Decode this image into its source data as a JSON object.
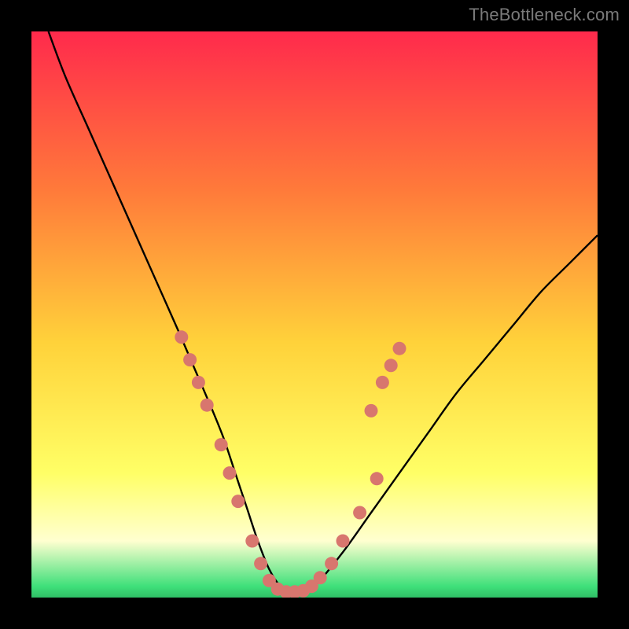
{
  "watermark": "TheBottleneck.com",
  "colors": {
    "gradient_top": "#ff2a4c",
    "gradient_mid_upper": "#ff7a3a",
    "gradient_mid": "#ffd23a",
    "gradient_lower": "#ffff66",
    "gradient_pale": "#ffffd0",
    "gradient_bottom": "#3fe07a",
    "curve": "#000000",
    "marker_fill": "#d8766e",
    "marker_stroke": "#bb5a52",
    "frame": "#000000"
  },
  "chart_data": {
    "type": "line",
    "title": "",
    "xlabel": "",
    "ylabel": "",
    "xlim": [
      0,
      100
    ],
    "ylim": [
      0,
      100
    ],
    "grid": false,
    "legend": false,
    "curve_note": "V-shaped bottleneck curve; y is percentage-like, 0 (bottom/green) is optimal, 100 (top/red) is worst. x is an unlabeled hardware-balance axis.",
    "series": [
      {
        "name": "bottleneck-curve",
        "x": [
          3,
          6,
          10,
          14,
          18,
          22,
          26,
          29,
          32,
          34,
          36,
          38,
          40,
          42,
          44,
          46,
          48,
          50,
          55,
          60,
          65,
          70,
          75,
          80,
          85,
          90,
          95,
          100
        ],
        "y": [
          100,
          92,
          83,
          74,
          65,
          56,
          47,
          40,
          33,
          28,
          22,
          16,
          10,
          5,
          2,
          1,
          1,
          2,
          8,
          15,
          22,
          29,
          36,
          42,
          48,
          54,
          59,
          64
        ]
      }
    ],
    "markers_note": "Salmon dots clustered on both arms of the V near the lower third of the chart.",
    "markers": {
      "name": "sample-points",
      "points": [
        {
          "x": 26.5,
          "y": 46
        },
        {
          "x": 28.0,
          "y": 42
        },
        {
          "x": 29.5,
          "y": 38
        },
        {
          "x": 31.0,
          "y": 34
        },
        {
          "x": 33.5,
          "y": 27
        },
        {
          "x": 35.0,
          "y": 22
        },
        {
          "x": 36.5,
          "y": 17
        },
        {
          "x": 39.0,
          "y": 10
        },
        {
          "x": 40.5,
          "y": 6
        },
        {
          "x": 42.0,
          "y": 3
        },
        {
          "x": 43.5,
          "y": 1.5
        },
        {
          "x": 45.0,
          "y": 1
        },
        {
          "x": 46.5,
          "y": 1
        },
        {
          "x": 48.0,
          "y": 1.2
        },
        {
          "x": 49.5,
          "y": 2
        },
        {
          "x": 51.0,
          "y": 3.5
        },
        {
          "x": 53.0,
          "y": 6
        },
        {
          "x": 55.0,
          "y": 10
        },
        {
          "x": 58.0,
          "y": 15
        },
        {
          "x": 61.0,
          "y": 21
        },
        {
          "x": 60.0,
          "y": 33
        },
        {
          "x": 62.0,
          "y": 38
        },
        {
          "x": 63.5,
          "y": 41
        },
        {
          "x": 65.0,
          "y": 44
        }
      ]
    }
  }
}
